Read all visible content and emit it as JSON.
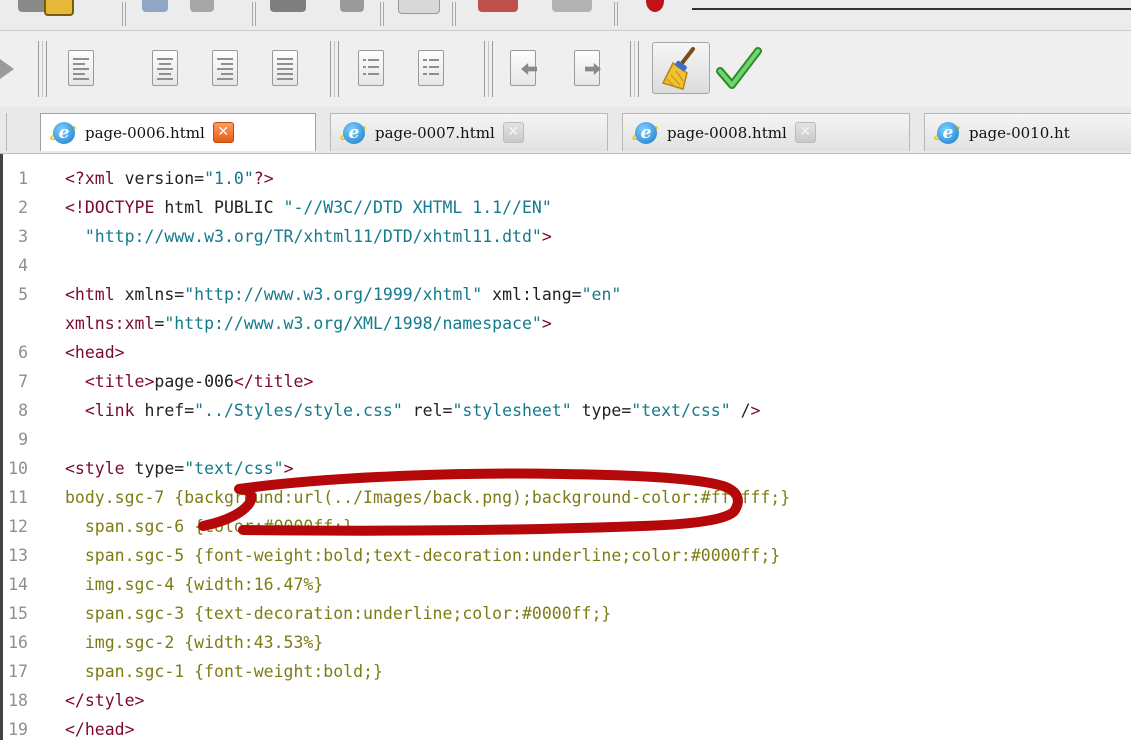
{
  "tabs": [
    {
      "label": "page-0006.html",
      "active": true,
      "icon": "ie-icon"
    },
    {
      "label": "page-0007.html",
      "active": false,
      "icon": "ie-icon"
    },
    {
      "label": "page-0008.html",
      "active": false,
      "icon": "ie-icon"
    },
    {
      "label": "page-0010.ht",
      "active": false,
      "icon": "ie-icon"
    }
  ],
  "toolbar": {
    "buttons": [
      "align-left-icon",
      "align-center-icon",
      "align-right-icon",
      "justify-icon",
      "bullet-list-icon",
      "numbered-list-icon",
      "outdent-icon",
      "indent-icon",
      "clean-broom-icon",
      "check-icon"
    ]
  },
  "editor": {
    "lines": [
      {
        "n": "1",
        "text": "<?xml version=\"1.0\"?>"
      },
      {
        "n": "2",
        "text": "<!DOCTYPE html PUBLIC \"-//W3C//DTD XHTML 1.1//EN\""
      },
      {
        "n": "3",
        "text": "  \"http://www.w3.org/TR/xhtml11/DTD/xhtml11.dtd\">"
      },
      {
        "n": "4",
        "text": ""
      },
      {
        "n": "5",
        "text": "<html xmlns=\"http://www.w3.org/1999/xhtml\" xml:lang=\"en\""
      },
      {
        "n": "",
        "text": "xmlns:xml=\"http://www.w3.org/XML/1998/namespace\">"
      },
      {
        "n": "6",
        "text": "<head>"
      },
      {
        "n": "7",
        "text": "  <title>page-006</title>"
      },
      {
        "n": "8",
        "text": "  <link href=\"../Styles/style.css\" rel=\"stylesheet\" type=\"text/css\" />"
      },
      {
        "n": "9",
        "text": ""
      },
      {
        "n": "10",
        "text": "<style type=\"text/css\">"
      },
      {
        "n": "11",
        "text": "body.sgc-7 {background:url(../Images/back.png);background-color:#ffffff;}"
      },
      {
        "n": "12",
        "text": "  span.sgc-6 {color:#0000ff;}"
      },
      {
        "n": "13",
        "text": "  span.sgc-5 {font-weight:bold;text-decoration:underline;color:#0000ff;}"
      },
      {
        "n": "14",
        "text": "  img.sgc-4 {width:16.47%}"
      },
      {
        "n": "15",
        "text": "  span.sgc-3 {text-decoration:underline;color:#0000ff;}"
      },
      {
        "n": "16",
        "text": "  img.sgc-2 {width:43.53%}"
      },
      {
        "n": "17",
        "text": "  span.sgc-1 {font-weight:bold;}"
      },
      {
        "n": "18",
        "text": "</style>"
      },
      {
        "n": "19",
        "text": "</head>"
      }
    ]
  },
  "annotation": {
    "color": "#b5080a",
    "target": "background:url(../Images/back.png);"
  }
}
